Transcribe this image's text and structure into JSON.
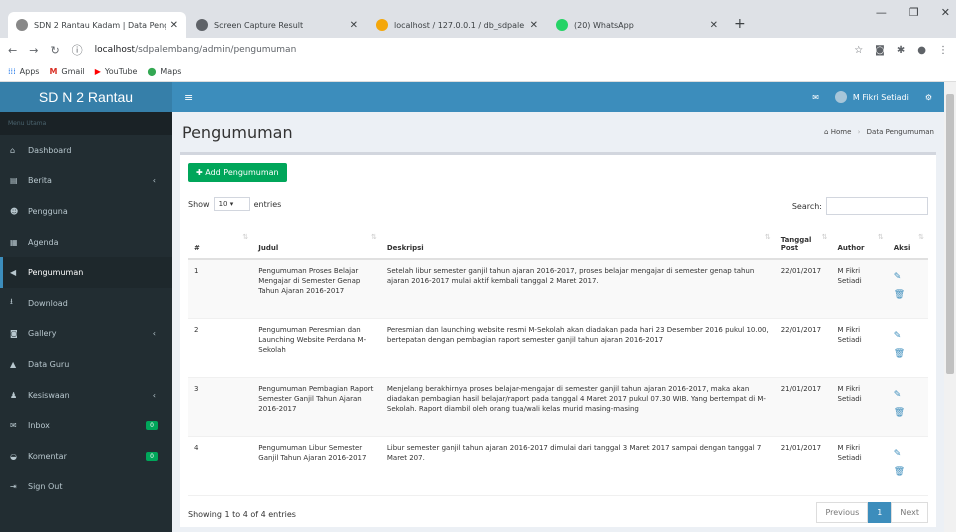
{
  "browser": {
    "tabs": [
      {
        "title": "SDN 2 Rantau Kadam | Data Peng",
        "color": "#888888"
      },
      {
        "title": "Screen Capture Result",
        "color": "#5f6368"
      },
      {
        "title": "localhost / 127.0.0.1 / db_sdpale",
        "color": "#f4a70b"
      },
      {
        "title": "(20) WhatsApp",
        "color": "#25d366"
      }
    ],
    "new_tab": "+",
    "url_host": "localhost",
    "url_path": "/sdpalembang/admin/pengumuman",
    "bookmarks": [
      "Apps",
      "Gmail",
      "YouTube",
      "Maps"
    ]
  },
  "app": {
    "logo": "SD N 2 Rantau",
    "user_name": "M Fikri Setiadi",
    "menu_header": "Menu Utama",
    "menu": [
      {
        "label": "Dashboard",
        "icon": "home-icon",
        "glyph": "⌂"
      },
      {
        "label": "Berita",
        "icon": "newspaper-icon",
        "glyph": "▤",
        "chevron": "‹"
      },
      {
        "label": "Pengguna",
        "icon": "users-icon",
        "glyph": "☻"
      },
      {
        "label": "Agenda",
        "icon": "calendar-icon",
        "glyph": "▦"
      },
      {
        "label": "Pengumuman",
        "icon": "bullhorn-icon",
        "glyph": "◀"
      },
      {
        "label": "Download",
        "icon": "download-icon",
        "glyph": "⭳"
      },
      {
        "label": "Gallery",
        "icon": "camera-icon",
        "glyph": "◙",
        "chevron": "‹"
      },
      {
        "label": "Data Guru",
        "icon": "graduation-icon",
        "glyph": "▲"
      },
      {
        "label": "Kesiswaan",
        "icon": "user-icon",
        "glyph": "♟",
        "chevron": "‹"
      },
      {
        "label": "Inbox",
        "icon": "envelope-icon",
        "glyph": "✉",
        "badge": "0"
      },
      {
        "label": "Komentar",
        "icon": "comments-icon",
        "glyph": "◒",
        "badge": "0"
      },
      {
        "label": "Sign Out",
        "icon": "sign-out-icon",
        "glyph": "⇥"
      }
    ],
    "active_index": 4
  },
  "page": {
    "title": "Pengumuman",
    "breadcrumb_home": "Home",
    "breadcrumb_current": "Data Pengumuman",
    "add_button": "Add Pengumuman",
    "show_label": "Show",
    "show_value": "10",
    "entries_label": "entries",
    "search_label": "Search:",
    "columns": [
      "#",
      "Judul",
      "Deskripsi",
      "Tanggal Post",
      "Author",
      "Aksi"
    ],
    "rows": [
      {
        "no": "1",
        "judul": "Pengumuman Proses Belajar Mengajar di Semester Genap Tahun Ajaran 2016-2017",
        "deskripsi": "Setelah libur semester ganjil tahun ajaran 2016-2017, proses belajar mengajar di semester genap tahun ajaran 2016-2017 mulai aktif kembali tanggal 2 Maret 2017.",
        "tanggal": "22/01/2017",
        "author": "M Fikri Setiadi"
      },
      {
        "no": "2",
        "judul": "Pengumuman Peresmian dan Launching Website Perdana M-Sekolah",
        "deskripsi": "Peresmian dan launching website resmi M-Sekolah akan diadakan pada hari 23 Desember 2016 pukul 10.00, bertepatan dengan pembagian raport semester ganjil tahun ajaran 2016-2017",
        "tanggal": "22/01/2017",
        "author": "M Fikri Setiadi"
      },
      {
        "no": "3",
        "judul": "Pengumuman Pembagian Raport Semester Ganjil Tahun Ajaran 2016-2017",
        "deskripsi": "Menjelang berakhirnya proses belajar-mengajar di semester ganjil tahun ajaran 2016-2017, maka akan diadakan pembagian hasil belajar/raport pada tanggal 4 Maret 2017 pukul 07.30 WIB. Yang bertempat di M-Sekolah. Raport diambil oleh orang tua/wali kelas murid masing-masing",
        "tanggal": "21/01/2017",
        "author": "M Fikri Setiadi"
      },
      {
        "no": "4",
        "judul": "Pengumuman Libur Semester Ganjil Tahun Ajaran 2016-2017",
        "deskripsi": "Libur semester ganjil tahun ajaran 2016-2017 dimulai dari tanggal 3 Maret 2017 sampai dengan tanggal 7 Maret 207.",
        "tanggal": "21/01/2017",
        "author": "M Fikri Setiadi"
      }
    ],
    "footer_info": "Showing 1 to 4 of 4 entries",
    "prev": "Previous",
    "current_page": "1",
    "next": "Next"
  }
}
